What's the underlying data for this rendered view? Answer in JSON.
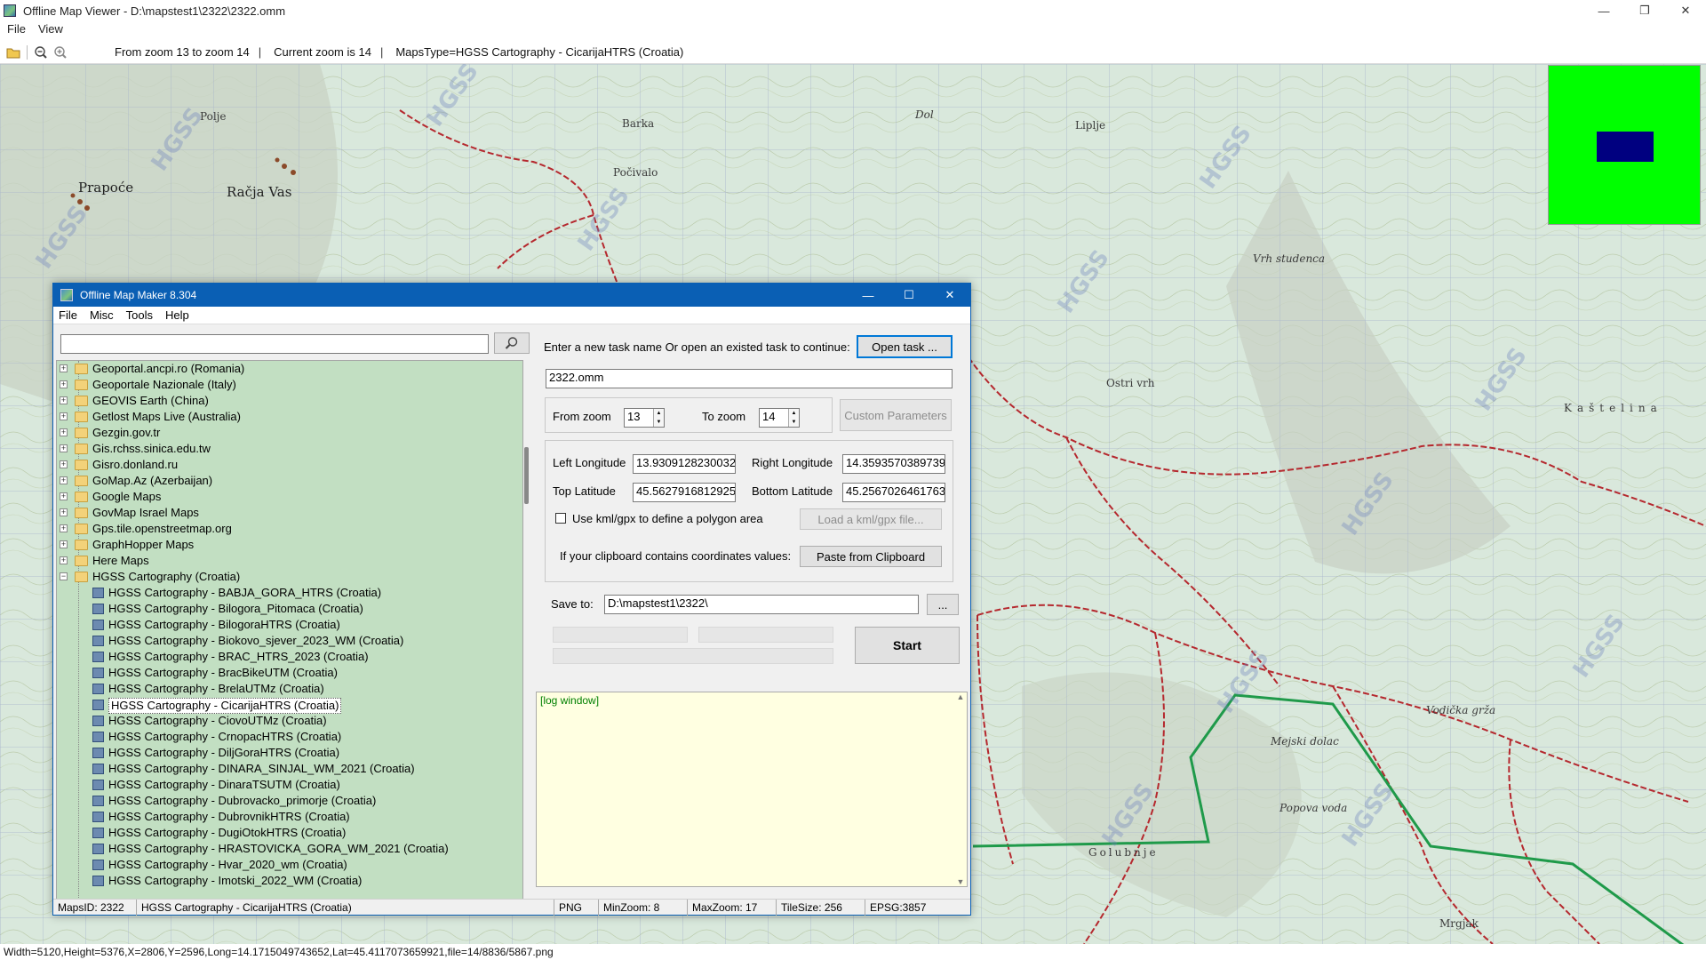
{
  "viewer": {
    "title": "Offline Map Viewer - D:\\mapstest1\\2322\\2322.omm",
    "menu": [
      "File",
      "View"
    ],
    "toolbar": {
      "zoom_range": "From zoom 13 to zoom 14",
      "current_zoom": "Current zoom is 14",
      "maps_type": "MapsType=HGSS Cartography - CicarijaHTRS (Croatia)"
    },
    "status": "Width=5120,Height=5376,X=2806,Y=2596,Long=14.1715049743652,Lat=45.4117073659921,file=14/8836/5867.png",
    "window_controls": {
      "minimize": "—",
      "maximize": "❐",
      "close": "✕"
    }
  },
  "map": {
    "labels": [
      {
        "text": "Prapoće",
        "cls": "big"
      },
      {
        "text": "Račja Vas",
        "cls": "big"
      },
      {
        "text": "Barka",
        "cls": ""
      },
      {
        "text": "Počivalo",
        "cls": ""
      },
      {
        "text": "Polje",
        "cls": ""
      },
      {
        "text": "Dol",
        "cls": "italic"
      },
      {
        "text": "Liplje",
        "cls": ""
      },
      {
        "text": "Ostri vrh",
        "cls": ""
      },
      {
        "text": "Vrh studenca",
        "cls": "italic"
      },
      {
        "text": "Kaštelina",
        "cls": ""
      },
      {
        "text": "Golubnje",
        "cls": ""
      },
      {
        "text": "Mejski dolac",
        "cls": "italic"
      },
      {
        "text": "Popova voda",
        "cls": "italic"
      },
      {
        "text": "Vodička grža",
        "cls": "italic"
      },
      {
        "text": "Mrgjak",
        "cls": ""
      }
    ],
    "watermark": "HGSS"
  },
  "dialog": {
    "title": "Offline Map Maker 8.304",
    "menu": [
      "File",
      "Misc",
      "Tools",
      "Help"
    ],
    "window_controls": {
      "minimize": "—",
      "maximize": "☐",
      "close": "✕"
    },
    "search": {
      "value": "",
      "placeholder": ""
    },
    "tree": {
      "folders": [
        "Geoportal.ancpi.ro (Romania)",
        "Geoportale Nazionale (Italy)",
        "GEOVIS Earth (China)",
        "Getlost Maps Live (Australia)",
        "Gezgin.gov.tr",
        "Gis.rchss.sinica.edu.tw",
        "Gisro.donland.ru",
        "GoMap.Az (Azerbaijan)",
        "Google Maps",
        "GovMap Israel Maps",
        "Gps.tile.openstreetmap.org",
        "GraphHopper Maps",
        "Here Maps"
      ],
      "open_folder": "HGSS Cartography (Croatia)",
      "children": [
        "HGSS Cartography - BABJA_GORA_HTRS (Croatia)",
        "HGSS Cartography - Bilogora_Pitomaca (Croatia)",
        "HGSS Cartography - BilogoraHTRS (Croatia)",
        "HGSS Cartography - Biokovo_sjever_2023_WM (Croatia)",
        "HGSS Cartography - BRAC_HTRS_2023 (Croatia)",
        "HGSS Cartography - BracBikeUTM (Croatia)",
        "HGSS Cartography - BrelaUTMz (Croatia)",
        "HGSS Cartography - CicarijaHTRS (Croatia)",
        "HGSS Cartography - CiovoUTMz (Croatia)",
        "HGSS Cartography - CrnopacHTRS (Croatia)",
        "HGSS Cartography - DiljGoraHTRS (Croatia)",
        "HGSS Cartography - DINARA_SINJAL_WM_2021 (Croatia)",
        "HGSS Cartography - DinaraTSUTM (Croatia)",
        "HGSS Cartography - Dubrovacko_primorje (Croatia)",
        "HGSS Cartography - DubrovnikHTRS (Croatia)",
        "HGSS Cartography - DugiOtokHTRS (Croatia)",
        "HGSS Cartography - HRASTOVICKA_GORA_WM_2021 (Croatia)",
        "HGSS Cartography - Hvar_2020_wm (Croatia)",
        "HGSS Cartography - Imotski_2022_WM (Croatia)"
      ],
      "selected_index": 7
    },
    "task": {
      "prompt": "Enter a new task name Or open an existed task to continue:",
      "open_button": "Open task ...",
      "name_value": "2322.omm"
    },
    "zoom": {
      "from_label": "From zoom",
      "from_value": "13",
      "to_label": "To zoom",
      "to_value": "14",
      "custom_button": "Custom Parameters"
    },
    "coords": {
      "left_lon_label": "Left Longitude",
      "left_lon_value": "13.9309128230032",
      "right_lon_label": "Right Longitude",
      "right_lon_value": "14.3593570389739",
      "top_lat_label": "Top Latitude",
      "top_lat_value": "45.5627916812925",
      "bottom_lat_label": "Bottom Latitude",
      "bottom_lat_value": "45.2567026461763",
      "kml_checkbox_label": "Use kml/gpx to define a polygon area",
      "kml_button": "Load a kml/gpx file...",
      "clipboard_label": "If your clipboard contains coordinates values:",
      "clipboard_button": "Paste from Clipboard"
    },
    "save": {
      "label": "Save to:",
      "value": "D:\\mapstest1\\2322\\",
      "browse_button": "...",
      "start_button": "Start"
    },
    "log": {
      "text": "[log window]"
    },
    "status": {
      "maps_id": "MapsID: 2322",
      "maps_name": "HGSS Cartography - CicarijaHTRS (Croatia)",
      "format": "PNG",
      "min_zoom": "MinZoom: 8",
      "max_zoom": "MaxZoom: 17",
      "tile_size": "TileSize: 256",
      "epsg": "EPSG:3857"
    }
  },
  "colors": {
    "map_bg": "#d9e8dc",
    "minimap_bg": "#00ff00",
    "minimap_view": "#000080",
    "tree_bg": "#c2dfc2",
    "dialog_title": "#0a5fb4",
    "log_bg": "#ffffe1",
    "road_red": "#b5282e",
    "boundary_green": "#1f9a4a"
  }
}
